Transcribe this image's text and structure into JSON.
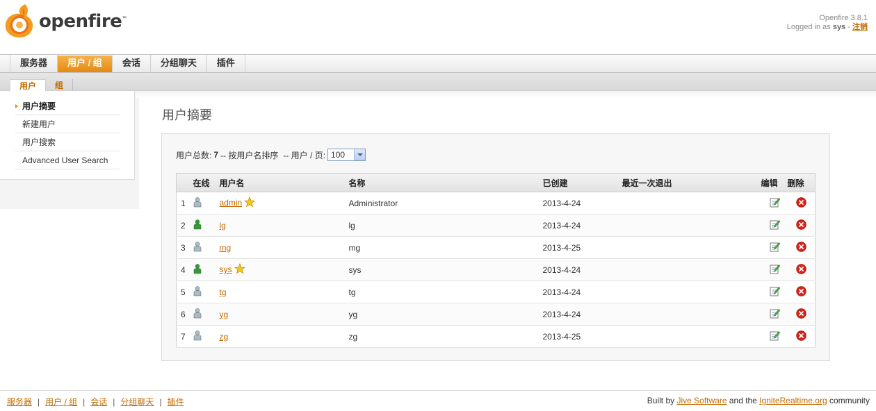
{
  "header": {
    "logo_text": "openfire",
    "logo_tm": "™",
    "version": "Openfire 3.8.1",
    "logged_in_prefix": "Logged in as",
    "username": "sys",
    "dash": "-",
    "logout": "注销"
  },
  "mainnav": [
    "服务器",
    "用户 / 组",
    "会话",
    "分组聊天",
    "插件"
  ],
  "subnav": [
    "用户",
    "组"
  ],
  "sidebar": [
    "用户摘要",
    "新建用户",
    "用户搜索",
    "Advanced User Search"
  ],
  "page_title": "用户摘要",
  "summary": {
    "total_label": "用户总数:",
    "total": "7",
    "sort_label": "-- 按用户名排序",
    "per_page_label": "-- 用户 / 页:",
    "per_page_value": "100"
  },
  "table": {
    "headers": {
      "online": "在线",
      "username": "用户名",
      "name": "名称",
      "created": "已创建",
      "last_logout": "最近一次退出",
      "edit": "编辑",
      "delete": "删除"
    },
    "rows": [
      {
        "num": "1",
        "online": false,
        "username": "admin",
        "star": true,
        "name": "Administrator",
        "created": "2013-4-24",
        "last": ""
      },
      {
        "num": "2",
        "online": true,
        "username": "lg",
        "star": false,
        "name": "lg",
        "created": "2013-4-24",
        "last": ""
      },
      {
        "num": "3",
        "online": false,
        "username": "mg",
        "star": false,
        "name": "mg",
        "created": "2013-4-25",
        "last": ""
      },
      {
        "num": "4",
        "online": true,
        "username": "sys",
        "star": true,
        "name": "sys",
        "created": "2013-4-24",
        "last": ""
      },
      {
        "num": "5",
        "online": false,
        "username": "tg",
        "star": false,
        "name": "tg",
        "created": "2013-4-24",
        "last": ""
      },
      {
        "num": "6",
        "online": false,
        "username": "yg",
        "star": false,
        "name": "yg",
        "created": "2013-4-24",
        "last": ""
      },
      {
        "num": "7",
        "online": false,
        "username": "zg",
        "star": false,
        "name": "zg",
        "created": "2013-4-25",
        "last": ""
      }
    ]
  },
  "footer": {
    "links": [
      "服务器",
      "用户 / 组",
      "会话",
      "分组聊天",
      "插件"
    ],
    "built_by": "Built by",
    "jive": "Jive Software",
    "and_the": "and the",
    "ignite": "IgniteRealtime.org",
    "community": "community"
  },
  "colors": {
    "accent": "#e58a10",
    "link": "#c36a00",
    "online_user": "#2e9e2e",
    "offline_user": "#a9bcc4",
    "delete": "#d9241a"
  }
}
